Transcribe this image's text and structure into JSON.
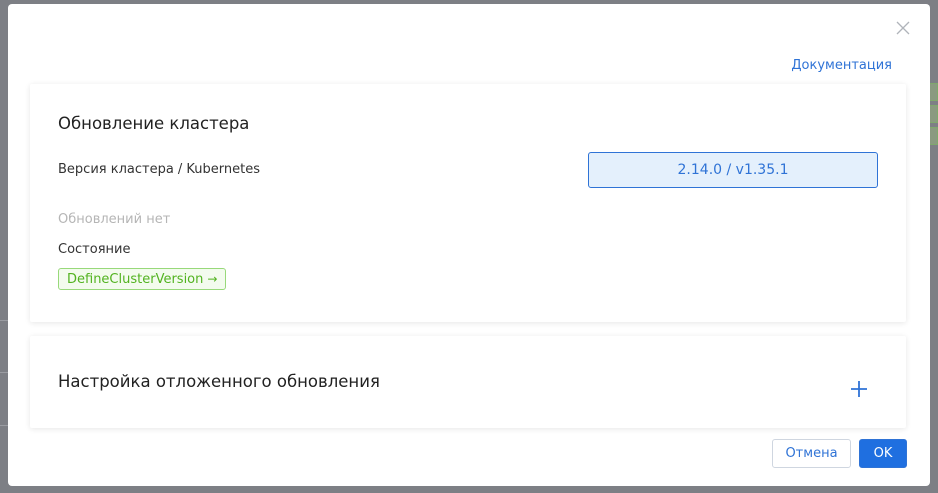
{
  "modal": {
    "doc_link": "Документация",
    "close_icon": "close-icon"
  },
  "cluster_update": {
    "title": "Обновление кластера",
    "version_label": "Версия кластера / Kubernetes",
    "version_value": "2.14.0 / v1.35.1",
    "no_updates": "Обновлений нет",
    "state_label": "Состояние",
    "state_value": "DefineClusterVersion",
    "state_arrow": "→"
  },
  "deferred_update": {
    "title": "Настройка отложенного обновления",
    "add_icon": "plus-icon"
  },
  "footer": {
    "cancel_label": "Отмена",
    "ok_label": "OK"
  },
  "colors": {
    "accent": "#2f73d6",
    "success": "#52b320",
    "overlay": "#7d7f85"
  }
}
